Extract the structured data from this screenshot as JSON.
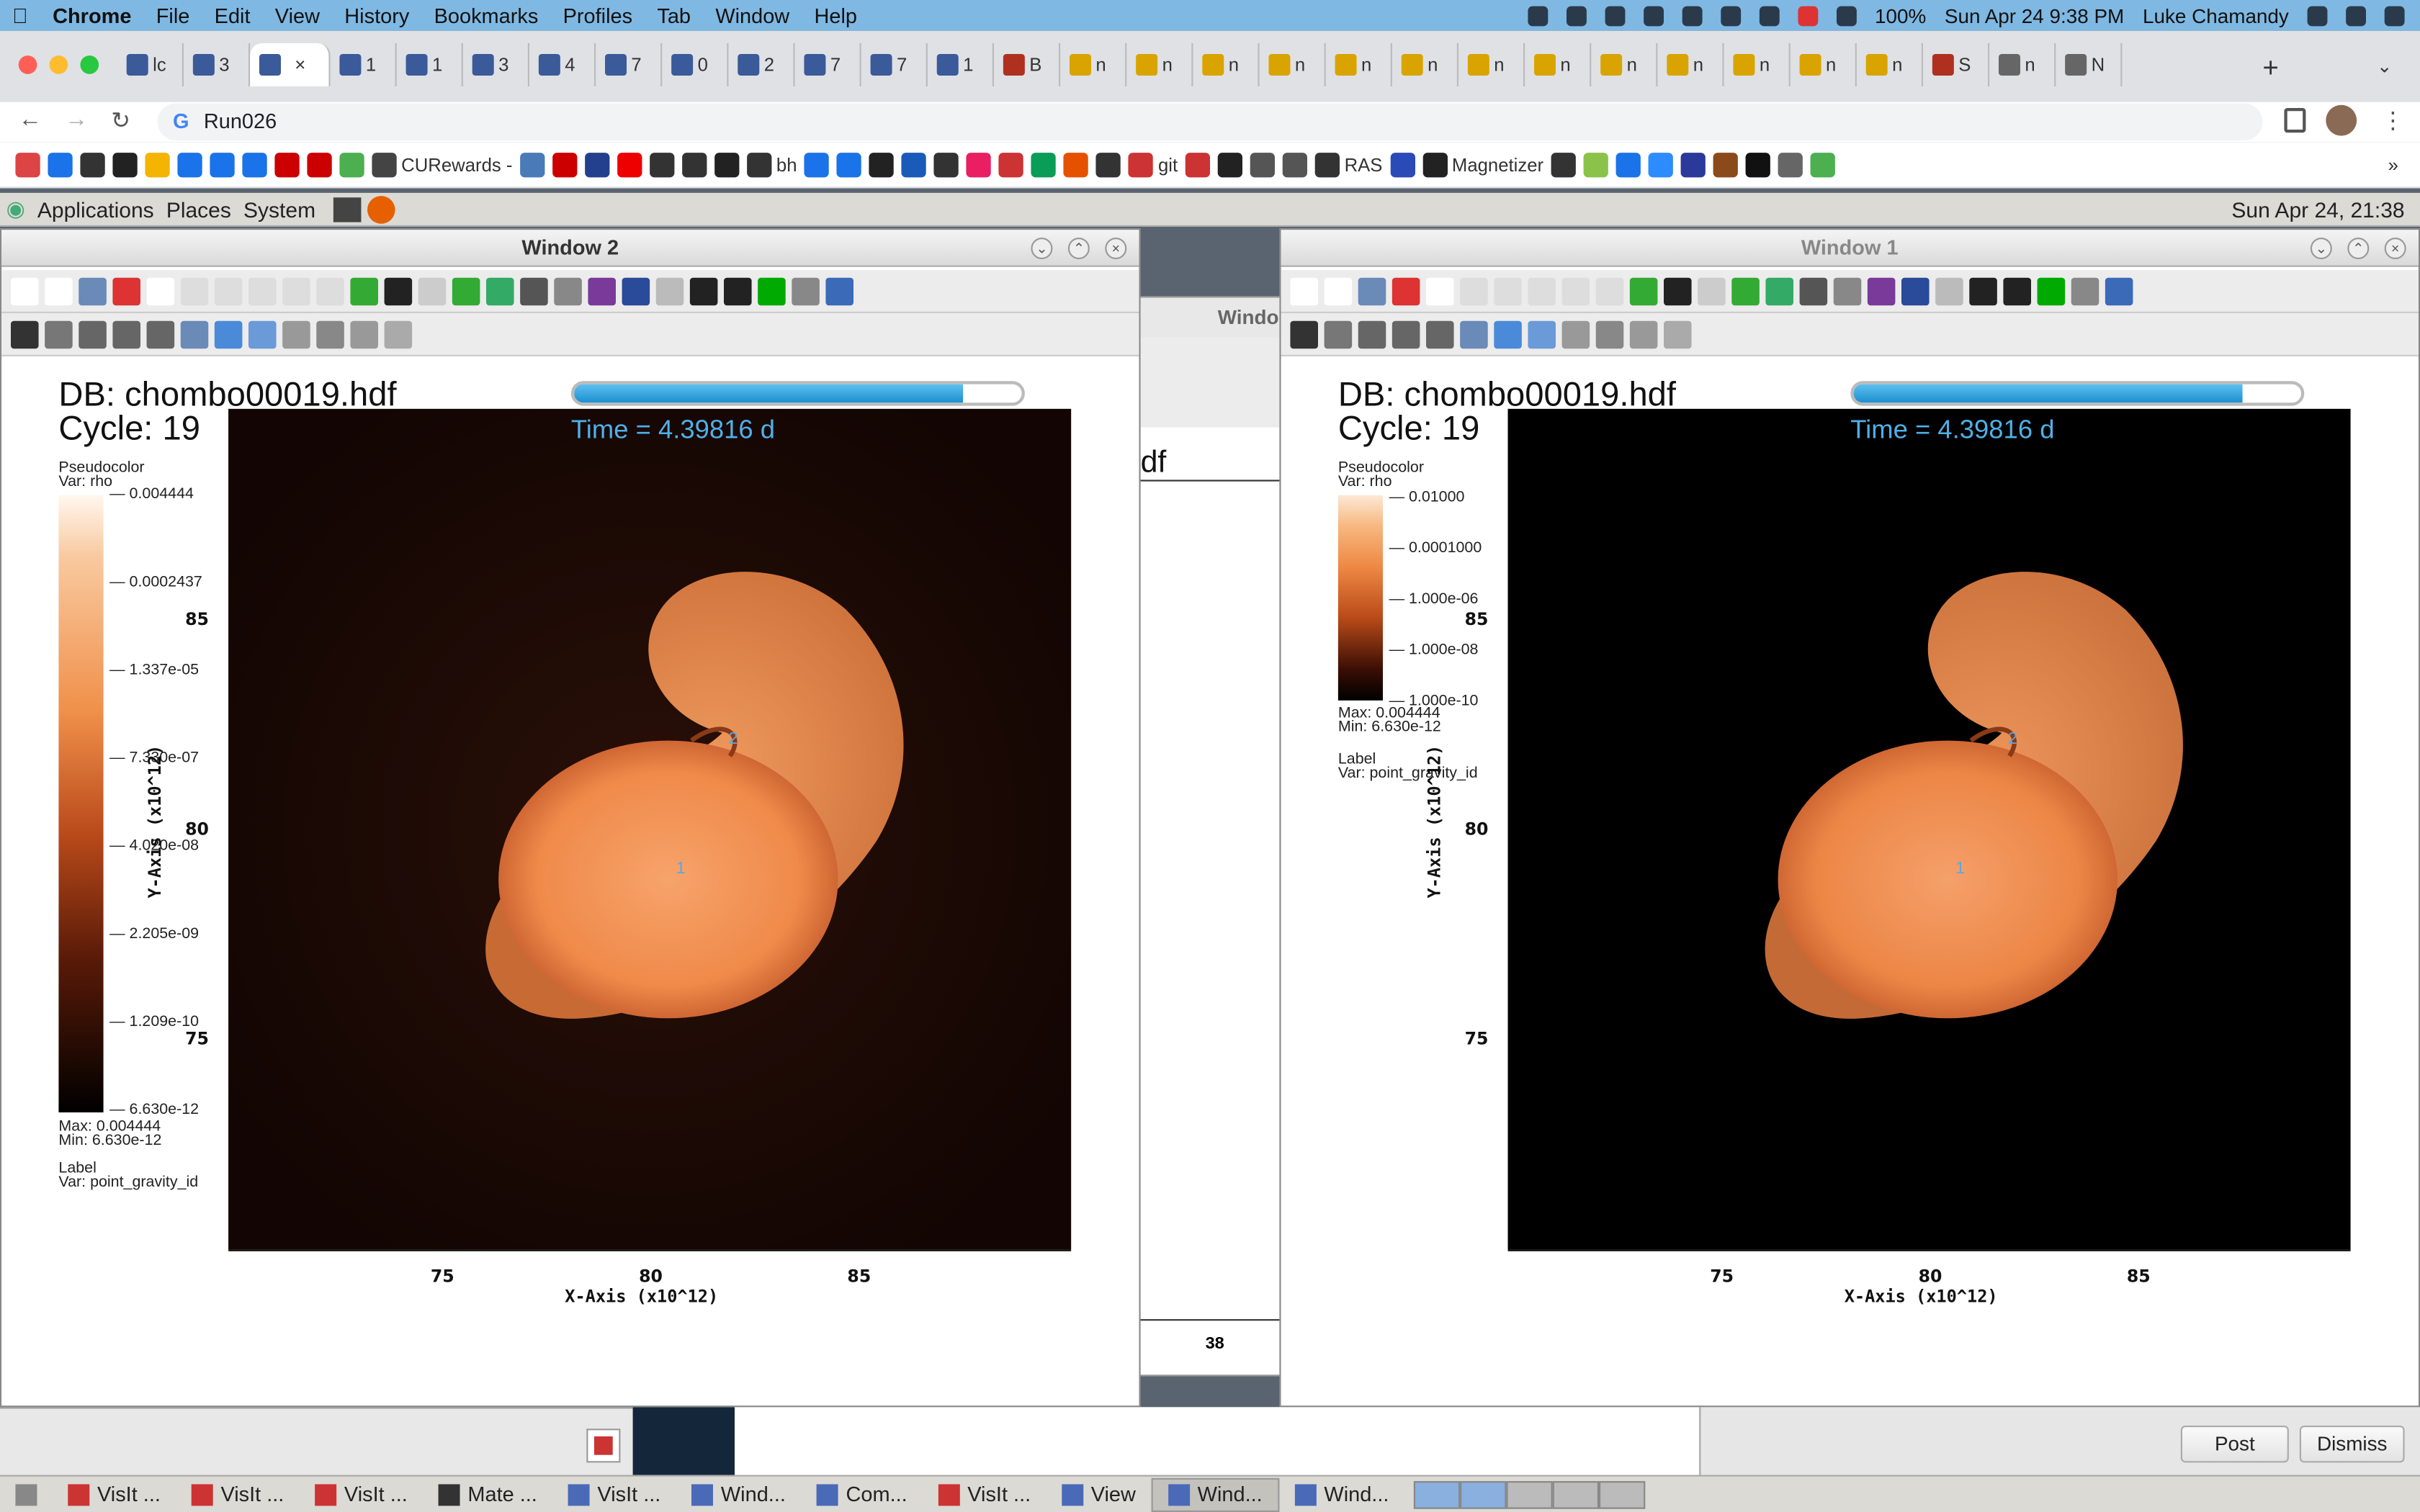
{
  "menubar": {
    "app": "Chrome",
    "items": [
      "File",
      "Edit",
      "View",
      "History",
      "Bookmarks",
      "Profiles",
      "Tab",
      "Window",
      "Help"
    ],
    "battery": "100%",
    "datetime": "Sun Apr 24  9:38 PM",
    "user": "Luke Chamandy"
  },
  "browser": {
    "address": "Run026",
    "tabs": [
      "lc",
      "3",
      "",
      "1",
      "1",
      "3",
      "4",
      "7",
      "0",
      "2",
      "7",
      "7",
      "1",
      "B",
      "n",
      "n",
      "n",
      "n",
      "n",
      "n",
      "n",
      "n",
      "n",
      "n",
      "n",
      "n",
      "n",
      "S",
      "n",
      "N"
    ],
    "bookmarks": [
      "",
      "",
      "",
      "",
      "",
      "",
      "",
      "",
      "",
      "",
      "",
      "CURewards -",
      "",
      "",
      "",
      "",
      "",
      "",
      "",
      "bh",
      "",
      "",
      "",
      "",
      "",
      "",
      "",
      "",
      "",
      "",
      "git",
      "",
      "",
      "",
      "",
      "RAS",
      "",
      "Magnetizer",
      "",
      "",
      "",
      "",
      "",
      "",
      "",
      "",
      ""
    ]
  },
  "gnome": {
    "menus": [
      "Applications",
      "Places",
      "System"
    ],
    "clock": "Sun Apr 24, 21:38"
  },
  "window2": {
    "title": "Window 2",
    "db": "DB: chombo00019.hdf",
    "cycle": "Cycle: 19",
    "time": "Time = 4.39816 d",
    "time_progress": 0.87,
    "legend": {
      "title": "Pseudocolor",
      "var": "Var: rho",
      "labels": [
        "0.004444",
        "0.0002437",
        "1.337e-05",
        "7.330e-07",
        "4.020e-08",
        "2.205e-09",
        "1.209e-10",
        "6.630e-12"
      ],
      "max": "Max:  0.004444",
      "min": "Min:  6.630e-12",
      "label_title": "Label",
      "label_var": "Var: point_gravity_id"
    },
    "xaxis": "X-Axis  (x10^12)",
    "yaxis": "Y-Axis  (x10^12)",
    "xticks": [
      "75",
      "80",
      "85"
    ],
    "yticks": [
      "85",
      "80",
      "75"
    ],
    "markers": [
      "2",
      "1"
    ]
  },
  "window1": {
    "title": "Window 1",
    "db": "DB: chombo00019.hdf",
    "cycle": "Cycle: 19",
    "time": "Time = 4.39816 d",
    "time_progress": 0.87,
    "legend": {
      "title": "Pseudocolor",
      "var": "Var: rho",
      "labels": [
        "0.01000",
        "0.0001000",
        "1.000e-06",
        "1.000e-08",
        "1.000e-10"
      ],
      "max": "Max:  0.004444",
      "min": "Min:  6.630e-12",
      "label_title": "Label",
      "label_var": "Var: point_gravity_id"
    },
    "xaxis": "X-Axis  (x10^12)",
    "yaxis": "Y-Axis  (x10^12)",
    "xticks": [
      "75",
      "80",
      "85"
    ],
    "yticks": [
      "85",
      "80",
      "75"
    ],
    "markers": [
      "2",
      "1"
    ]
  },
  "background_window": {
    "title": "Windo",
    "fragment": "df",
    "tick": "38"
  },
  "buttons": {
    "post": "Post",
    "dismiss": "Dismiss"
  },
  "taskbar": [
    "VisIt ...",
    "VisIt ...",
    "VisIt ...",
    "Mate ...",
    "VisIt ...",
    "Wind...",
    "Com...",
    "VisIt ...",
    "View",
    "Wind...",
    "Wind..."
  ],
  "colors": {
    "accent": "#1b8fcf",
    "menubar": "#7fb8e2"
  }
}
